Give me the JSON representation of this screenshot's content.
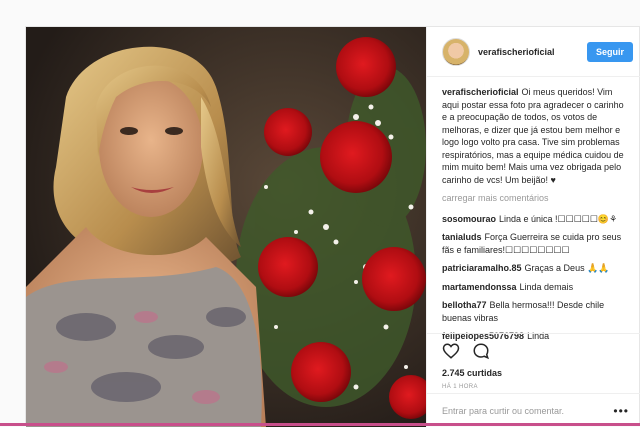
{
  "profile": {
    "username": "verafischerioficial",
    "follow_label": "Seguir"
  },
  "caption": {
    "user": "verafischerioficial",
    "text": "Oi meus queridos! Vim aqui postar essa foto pra agradecer o carinho e a preocupação de todos, os votos de melhoras, e dizer que já estou bem melhor e logo logo volto pra casa. Tive sim problemas respiratórios, mas a equipe médica cuidou de mim muito bem! Mais uma vez obrigada pelo carinho de vcs! Um beijão! ♥"
  },
  "load_more_label": "carregar mais comentários",
  "comments": [
    {
      "user": "sosomourao",
      "text": "Linda e única !☐☐☐☐☐😊⚘"
    },
    {
      "user": "tanialuds",
      "text": "Força Guerreira se cuida pro seus fãs e familiares!☐☐☐☐☐☐☐☐"
    },
    {
      "user": "patriciaramalho.85",
      "text": "Graças a Deus 🙏🙏"
    },
    {
      "user": "martamendonssa",
      "text": "Linda demais"
    },
    {
      "user": "bellotha77",
      "text": "Bella hermosa!!! Desde chile buenas vibras"
    },
    {
      "user": "felipelopes5076798",
      "text": "Linda"
    }
  ],
  "likes": "2.745 curtidas",
  "time": "HÁ 1 HORA",
  "comment_input": {
    "placeholder": "Entrar para curtir ou comentar."
  },
  "more_label": "•••",
  "icons": {
    "like": "heart-icon",
    "comment": "comment-icon",
    "options": "more-options-icon"
  },
  "colors": {
    "follow_button": "#3897f0",
    "background": "#fafafa",
    "border": "#efefef"
  }
}
